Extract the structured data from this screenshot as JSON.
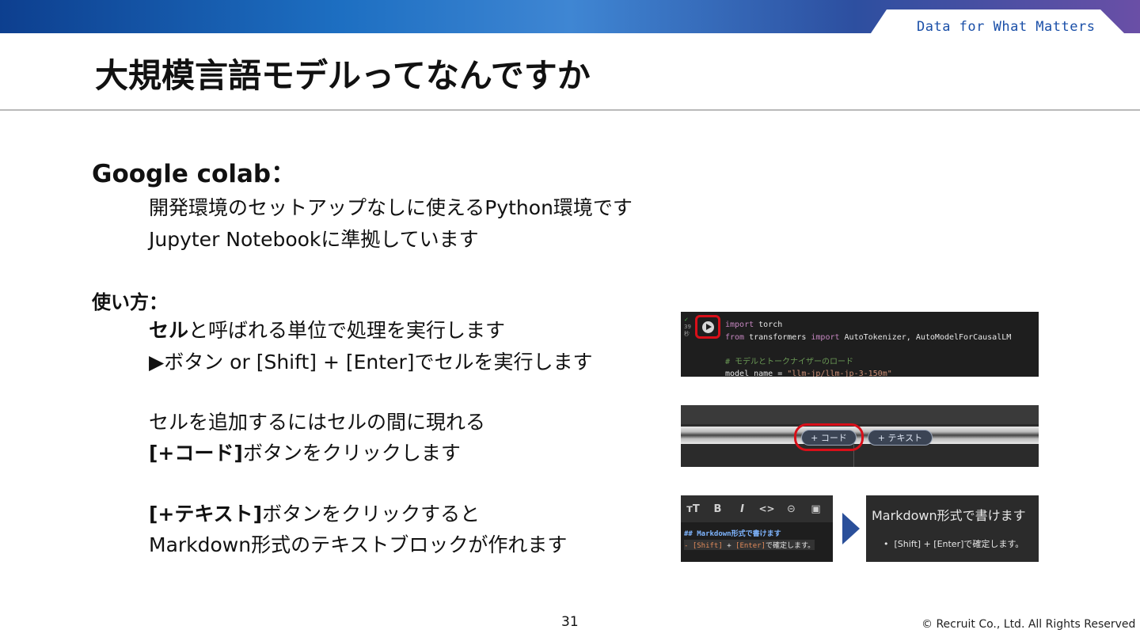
{
  "header": {
    "tagline": "Data for What Matters",
    "title": "大規模言語モデルってなんですか"
  },
  "colab": {
    "heading": "Google colab：",
    "lines": [
      "開発環境のセットアップなしに使えるPython環境です",
      "Jupyter Notebookに準拠しています"
    ]
  },
  "usage": {
    "heading": "使い方：",
    "cell_bold": "セル",
    "cell_rest": "と呼ばれる単位で処理を実行します",
    "run_line": "▶ボタン or [Shift] + [Enter]でセルを実行します",
    "add_line": "セルを追加するにはセルの間に現れる",
    "code_bold": "[+コード]",
    "code_rest": "ボタンをクリックします",
    "text_bold": "[+テキスト]",
    "text_rest": "ボタンをクリックすると",
    "markdown_line": "Markdown形式のテキストブロックが作れます"
  },
  "shot_code": {
    "gutter": [
      "✓",
      "39",
      "秒"
    ],
    "lines": [
      [
        {
          "t": "import",
          "c": "#c586c0"
        },
        {
          "t": " torch",
          "c": "#e6e6e6"
        }
      ],
      [
        {
          "t": "from",
          "c": "#c586c0"
        },
        {
          "t": " transformers ",
          "c": "#e6e6e6"
        },
        {
          "t": "import",
          "c": "#c586c0"
        },
        {
          "t": " AutoTokenizer, AutoModelForCausalLM",
          "c": "#e6e6e6"
        }
      ],
      [],
      [
        {
          "t": "# モデルとトークナイザーのロード",
          "c": "#6a9955"
        }
      ],
      [
        {
          "t": "model_name = ",
          "c": "#e6e6e6"
        },
        {
          "t": "\"llm-jp/llm-jp-3-150m\"",
          "c": "#ce9178"
        }
      ]
    ]
  },
  "shot_add": {
    "code_button": "+ コード",
    "text_button": "+ テキスト"
  },
  "shot_md": {
    "toolbar": [
      "тT",
      "B",
      "I",
      "<>",
      "⊝",
      "▣"
    ],
    "line1": "## Markdown形式で書けます",
    "line2_pre": "- ",
    "line2_shift": "[Shift]",
    "line2_plus": " + ",
    "line2_enter": "[Enter]",
    "line2_post": "で確定します。"
  },
  "shot_rendered": {
    "heading": "Markdown形式で書けます",
    "bullet": "[Shift] + [Enter]で確定します。"
  },
  "footer": {
    "page": "31",
    "copyright": "© Recruit Co., Ltd. All Rights Reserved"
  },
  "colors": {
    "accent_red": "#d90f19",
    "arrow_blue": "#2a4f9a",
    "dark_panel": "#2b2b2b"
  }
}
